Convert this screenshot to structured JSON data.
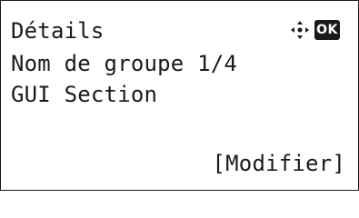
{
  "header": {
    "title": "Détails",
    "nav_icon": "four-way-navigation-icon",
    "ok_badge": "OK"
  },
  "content": {
    "line1": "Nom de groupe 1/4",
    "line2": "GUI Section"
  },
  "softkey": {
    "label": "[Modifier]"
  }
}
